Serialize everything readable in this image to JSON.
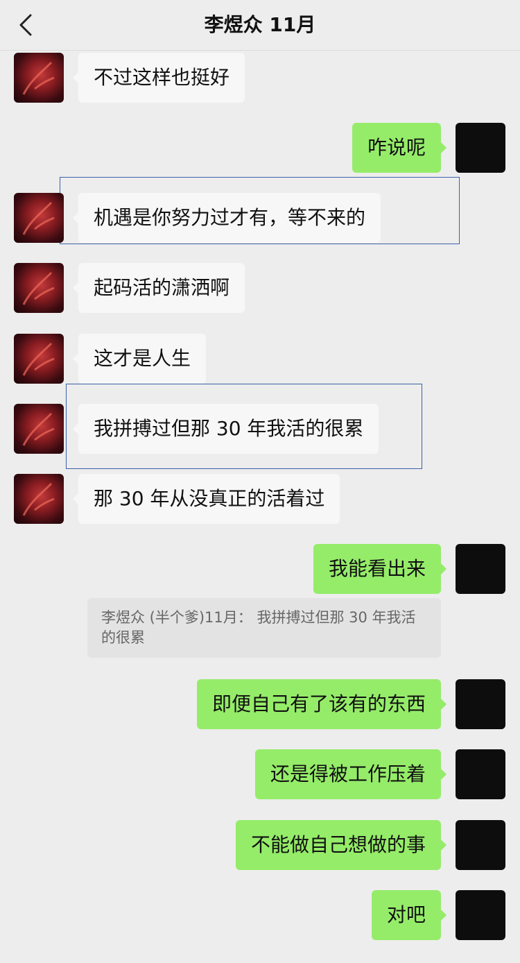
{
  "header": {
    "back_icon": "chevron-left-icon",
    "title": "李煜众 11月"
  },
  "messages": [
    {
      "side": "them",
      "text": "不过这样也挺好"
    },
    {
      "side": "me",
      "text": "咋说呢"
    },
    {
      "side": "them",
      "text": "机遇是你努力过才有，等不来的",
      "highlighted": true
    },
    {
      "side": "them",
      "text": "起码活的潇洒啊"
    },
    {
      "side": "them",
      "text": "这才是人生"
    },
    {
      "side": "them",
      "text": "我拼搏过但那 30 年我活的很累",
      "highlighted": true
    },
    {
      "side": "them",
      "text": "那 30 年从没真正的活着过"
    },
    {
      "side": "me",
      "text": "我能看出来"
    },
    {
      "side": "me",
      "text": "即便自己有了该有的东西"
    },
    {
      "side": "me",
      "text": "还是得被工作压着"
    },
    {
      "side": "me",
      "text": "不能做自己想做的事"
    },
    {
      "side": "me",
      "text": "对吧"
    }
  ],
  "quote": {
    "text": "李煜众 (半个爹)11月： 我拼搏过但那 30 年我活的很累"
  },
  "colors": {
    "background": "#ededed",
    "my_bubble": "#95ec69",
    "their_bubble": "#f7f7f7",
    "highlight_border": "#3b5fa8"
  }
}
